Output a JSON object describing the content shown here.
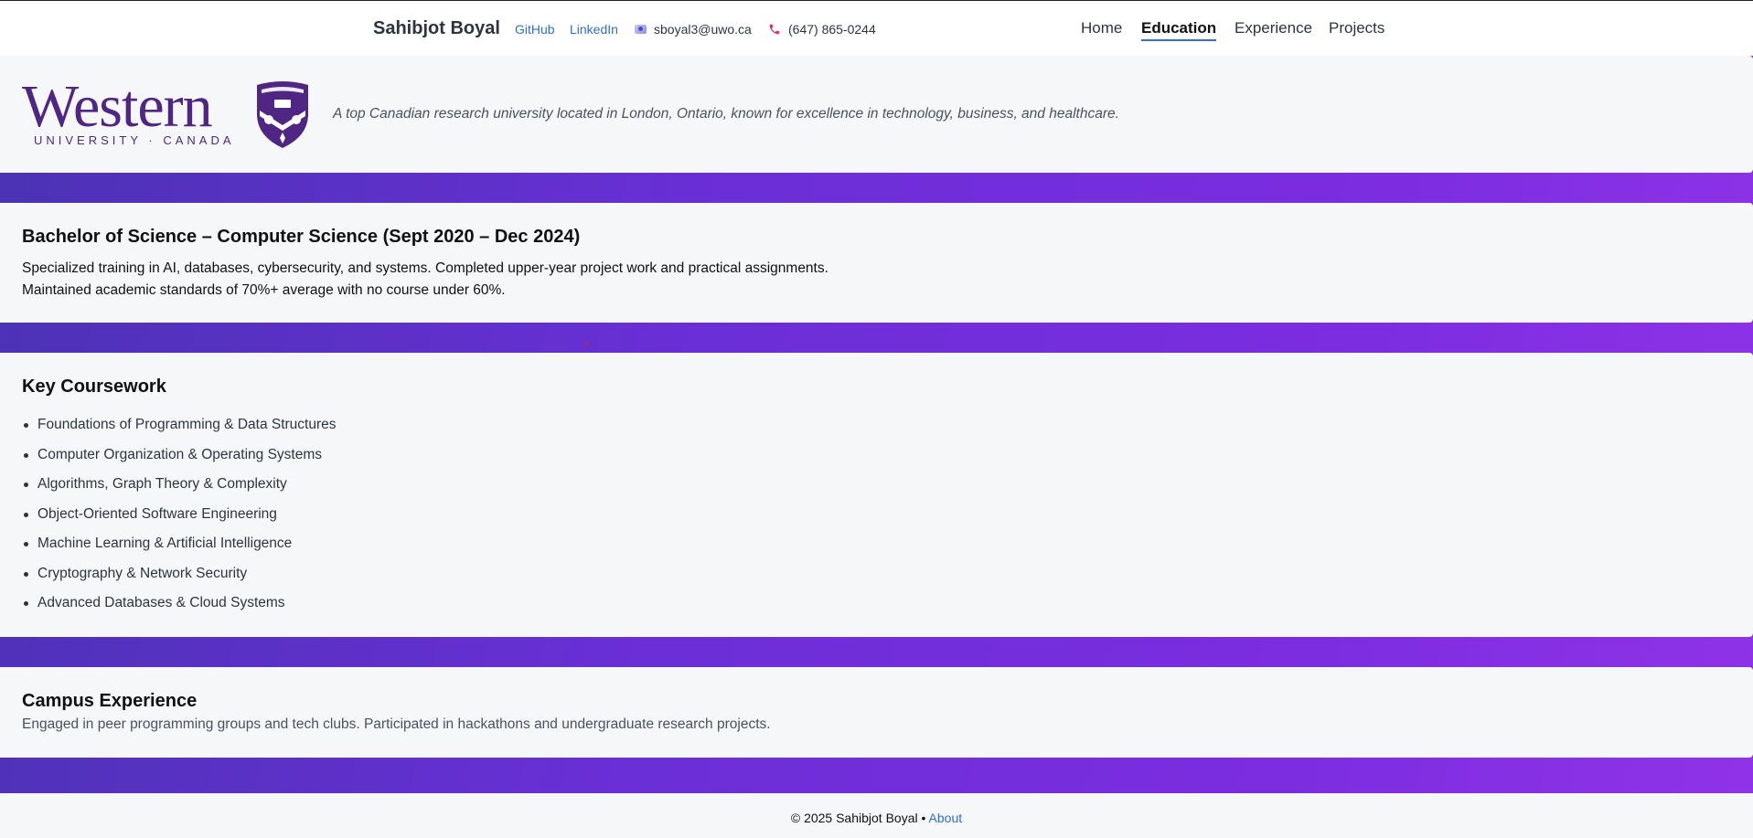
{
  "nav": {
    "brand": "Sahibjot Boyal",
    "github": "GitHub",
    "linkedin": "LinkedIn",
    "email": "sboyal3@uwo.ca",
    "phone": "(647) 865-0244",
    "menu": [
      "Home",
      "Education",
      "Experience",
      "Projects"
    ],
    "active": "Education"
  },
  "hero": {
    "logo_word": "Western",
    "logo_sub": "UNIVERSITY · CANADA",
    "tagline": "A top Canadian research university located in London, Ontario, known for excellence in technology, business, and healthcare."
  },
  "degree": {
    "title": "Bachelor of Science – Computer Science (Sept 2020 – Dec 2024)",
    "line1": "Specialized training in AI, databases, cybersecurity, and systems. Completed upper-year project work and practical assignments.",
    "line2": "Maintained academic standards of 70%+ average with no course under 60%."
  },
  "coursework": {
    "title": "Key Coursework",
    "items": [
      "Foundations of Programming & Data Structures",
      "Computer Organization & Operating Systems",
      "Algorithms, Graph Theory & Complexity",
      "Object-Oriented Software Engineering",
      "Machine Learning & Artificial Intelligence",
      "Cryptography & Network Security",
      "Advanced Databases & Cloud Systems"
    ]
  },
  "campus": {
    "title": "Campus Experience",
    "text": "Engaged in peer programming groups and tech clubs. Participated in hackathons and undergraduate research projects."
  },
  "footer": {
    "copyright": "© 2025 Sahibjot Boyal •",
    "about": "About"
  },
  "colors": {
    "brand_purple": "#4f2683",
    "link_blue": "#2f6fd0",
    "gradient_start": "#4a33b4",
    "gradient_end": "#9033e8"
  },
  "icons": [
    "email-icon",
    "phone-icon",
    "university-crest-icon"
  ]
}
